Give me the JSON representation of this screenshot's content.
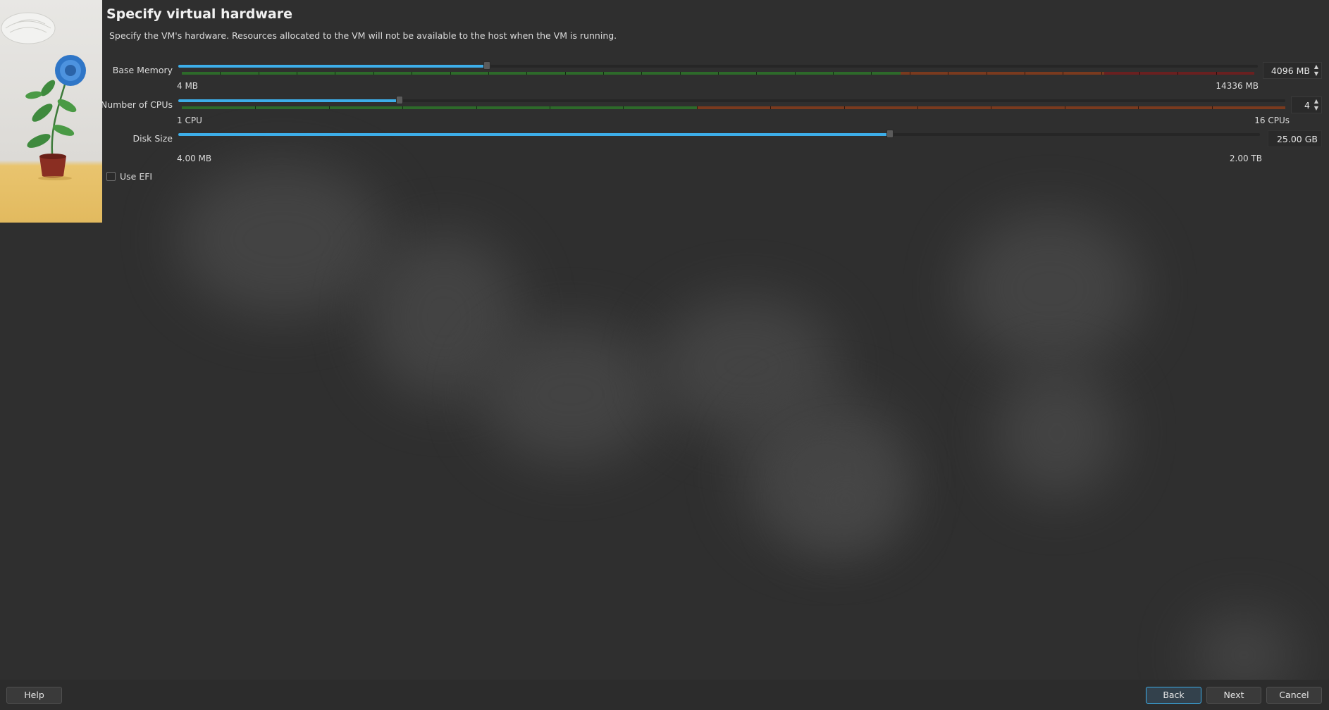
{
  "header": {
    "title": "Specify virtual hardware",
    "subtitle": "Specify the VM's hardware. Resources allocated to the VM will not be available to the host when the VM is running."
  },
  "memory": {
    "label": "Base Memory",
    "min_label": "4 MB",
    "max_label": "14336 MB",
    "value_text": "4096 MB",
    "value_fraction": 0.286,
    "green_fraction": 0.67,
    "orange_fraction": 0.86
  },
  "cpus": {
    "label": "Number of CPUs",
    "min_label": "1 CPU",
    "max_label": "16 CPUs",
    "value_text": "4",
    "value_fraction": 0.2,
    "green_fraction": 0.467
  },
  "disk": {
    "label": "Disk Size",
    "min_label": "4.00 MB",
    "max_label": "2.00 TB",
    "value_text": "25.00 GB",
    "value_fraction": 0.658
  },
  "efi": {
    "label": "Use EFI",
    "checked": false
  },
  "buttons": {
    "help": "Help",
    "back": "Back",
    "next": "Next",
    "cancel": "Cancel"
  },
  "colors": {
    "accent": "#3daee9",
    "ok": "#2d6a2a",
    "warn": "#7a3a1e",
    "danger": "#6a2020"
  }
}
